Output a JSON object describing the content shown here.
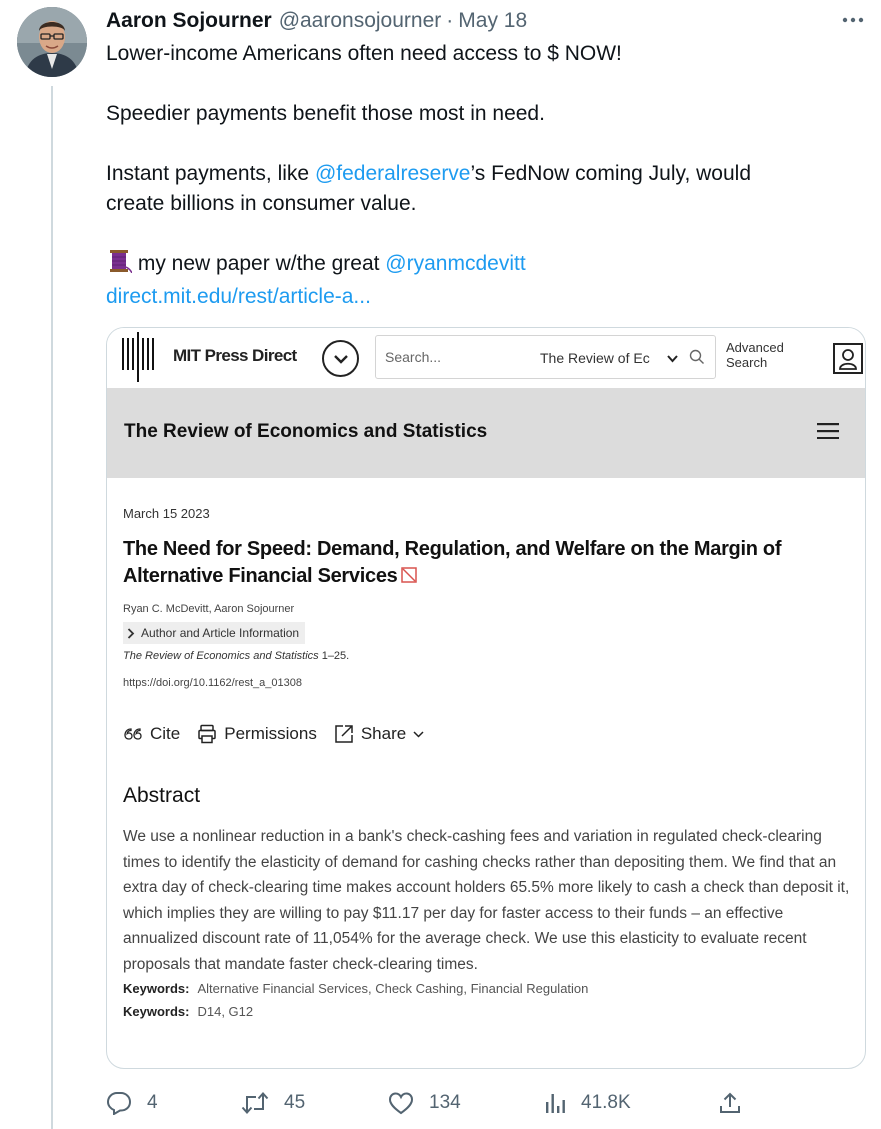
{
  "tweet": {
    "author_name": "Aaron Sojourner",
    "author_handle": "@aaronsojourner",
    "separator": "·",
    "date": "May 18",
    "line1": "Lower-income Americans often need access to $ NOW!",
    "line2": "Speedier payments benefit those most in need.",
    "line3_prefix": "Instant payments, like ",
    "line3_mention": "@federalreserve",
    "line3_suffix": "’s FedNow coming July, would",
    "line4": "create billions in consumer value.",
    "line5_prefix": " my new paper w/the great ",
    "line5_mention": "@ryanmcdevitt",
    "link": "direct.mit.edu/rest/article-a..."
  },
  "card": {
    "site_name": "MIT Press Direct",
    "search_placeholder": "Search...",
    "search_scope": "The Review of Ec",
    "advanced_search": "Advanced Search",
    "journal_name": "The Review of Economics and Statistics",
    "pub_date": "March 15 2023",
    "article_title": "The Need for Speed: Demand, Regulation, and Welfare on the Margin of Alternative Financial Services",
    "authors": "Ryan C. McDevitt, Aaron Sojourner",
    "author_info_label": "Author and Article Information",
    "citation_journal": "The Review of Economics and Statistics",
    "citation_pages": " 1–25.",
    "doi": "https://doi.org/10.1162/rest_a_01308",
    "cite_label": "Cite",
    "permissions_label": "Permissions",
    "share_label": "Share",
    "abstract_heading": "Abstract",
    "abstract_text": "We use a nonlinear reduction in a bank's check-cashing fees and variation in regulated check-clearing times to identify the elasticity of demand for cashing checks rather than depositing them. We find that an extra day of check-clearing time makes account holders 65.5% more likely to cash a check than deposit it, which implies they are willing to pay $11.17 per day for faster access to their funds – an effective annualized discount rate of 11,054% for the average check. We use this elasticity to evaluate recent proposals that mandate faster check-clearing times.",
    "keywords_label": "Keywords:",
    "keywords_1": "Alternative Financial Services, Check Cashing, Financial Regulation",
    "keywords_2": "D14, G12"
  },
  "actions": {
    "replies": "4",
    "retweets": "45",
    "likes": "134",
    "views": "41.8K"
  },
  "colors": {
    "link": "#1d9bf0",
    "muted": "#536471",
    "journal_bar": "#dcdcdc"
  },
  "icons": [
    "more-icon",
    "thread-emoji-icon",
    "mit-logo-icon",
    "chevron-down-icon",
    "search-icon",
    "user-icon",
    "hamburger-icon",
    "pdf-icon",
    "cite-icon",
    "permissions-icon",
    "share-icon",
    "reply-icon",
    "retweet-icon",
    "like-icon",
    "views-icon",
    "upload-icon"
  ]
}
